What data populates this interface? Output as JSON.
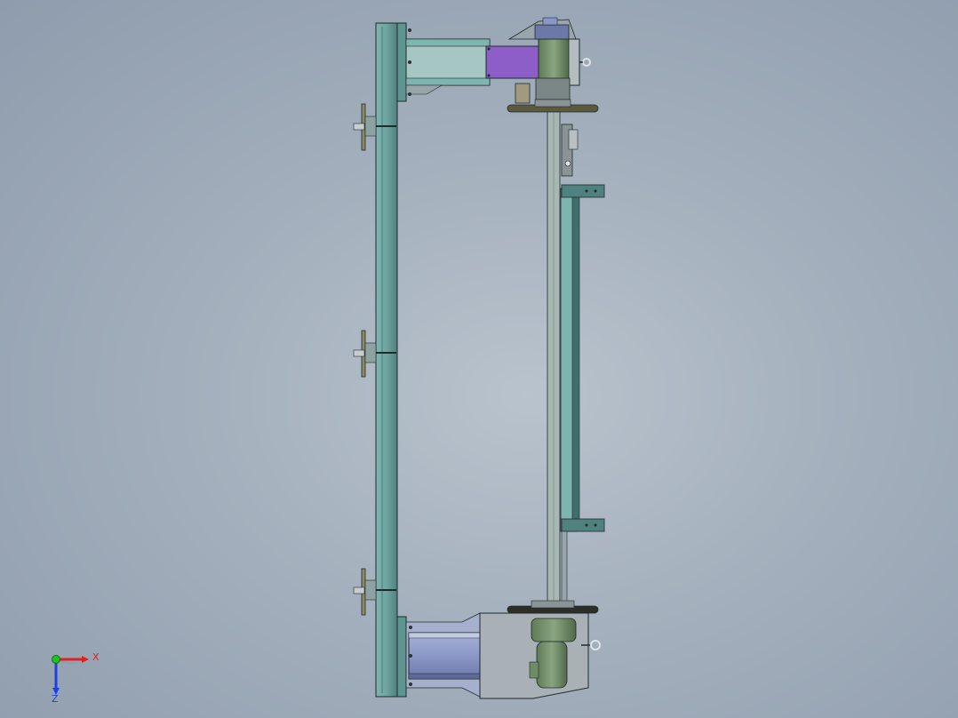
{
  "viewport": {
    "background_center": "#b9c3cd",
    "background_edge": "#8e9cad"
  },
  "model": {
    "colors": {
      "frame_teal": "#6fa5a1",
      "frame_dark": "#3f6e6c",
      "beam_blue": "#8b97c7",
      "motor_purple": "#8d5ec8",
      "gear_green": "#6f8c66",
      "steel_gray": "#9aa4ab",
      "outline": "#1e2a2c"
    }
  },
  "triad": {
    "x_label": "X",
    "z_label": "Z",
    "x_color": "#e02020",
    "y_color": "#20c020",
    "z_color": "#2040e0"
  }
}
